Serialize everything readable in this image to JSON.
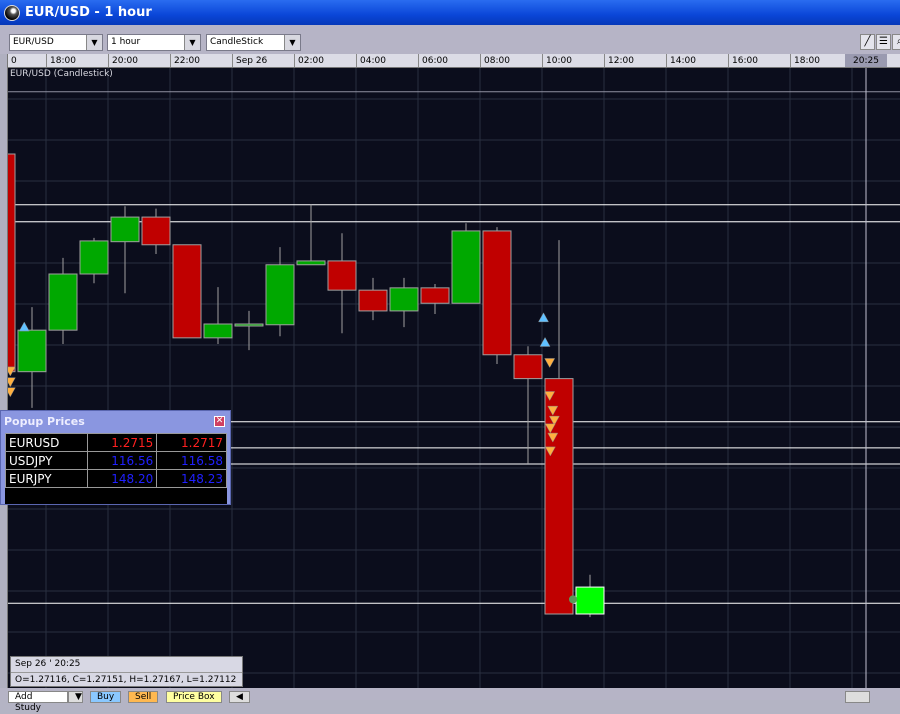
{
  "window": {
    "title": "EUR/USD - 1 hour"
  },
  "toolbar": {
    "symbol": "EUR/USD",
    "interval": "1 hour",
    "chart_type": "CandleStick",
    "tools": [
      "draw-line-icon",
      "horizontal-lines-icon",
      "zoom-icon"
    ]
  },
  "time_axis": {
    "labels": [
      "0",
      "18:00",
      "20:00",
      "22:00",
      "Sep 26",
      "02:00",
      "04:00",
      "06:00",
      "08:00",
      "10:00",
      "12:00",
      "14:00",
      "16:00",
      "18:00"
    ],
    "cursor_label": "20:25"
  },
  "chart": {
    "title": "EUR/USD (Candlestick)",
    "colors": {
      "up": "#00a800",
      "down": "#c00000",
      "last_up": "#00ff00",
      "background": "#0b0d1c",
      "grid": "#2a3040",
      "buy_marker": "#60c0ff",
      "sell_marker": "#ffb040"
    },
    "price_scale": {
      "ref_price": 1.27116
    },
    "candles": [
      {
        "o": 1.27714,
        "h": 1.27714,
        "l": 1.27431,
        "c": 1.27431
      },
      {
        "o": 1.27431,
        "h": 1.27515,
        "l": 1.27384,
        "c": 1.27485
      },
      {
        "o": 1.27485,
        "h": 1.27579,
        "l": 1.27467,
        "c": 1.27558
      },
      {
        "o": 1.27558,
        "h": 1.27605,
        "l": 1.27546,
        "c": 1.27601
      },
      {
        "o": 1.276,
        "h": 1.27646,
        "l": 1.27533,
        "c": 1.27632
      },
      {
        "o": 1.27632,
        "h": 1.27643,
        "l": 1.27584,
        "c": 1.27596
      },
      {
        "o": 1.27596,
        "h": 1.27596,
        "l": 1.27475,
        "c": 1.27475
      },
      {
        "o": 1.27475,
        "h": 1.27541,
        "l": 1.27467,
        "c": 1.27493
      },
      {
        "o": 1.27493,
        "h": 1.2751,
        "l": 1.27459,
        "c": 1.27493
      },
      {
        "o": 1.27492,
        "h": 1.27593,
        "l": 1.27477,
        "c": 1.2757
      },
      {
        "o": 1.2757,
        "h": 1.27648,
        "l": 1.2757,
        "c": 1.27575
      },
      {
        "o": 1.27575,
        "h": 1.27611,
        "l": 1.27481,
        "c": 1.27537
      },
      {
        "o": 1.27537,
        "h": 1.27553,
        "l": 1.27498,
        "c": 1.2751
      },
      {
        "o": 1.2751,
        "h": 1.27553,
        "l": 1.27489,
        "c": 1.2754
      },
      {
        "o": 1.2754,
        "h": 1.27545,
        "l": 1.27506,
        "c": 1.2752
      },
      {
        "o": 1.2752,
        "h": 1.27624,
        "l": 1.2752,
        "c": 1.27614
      },
      {
        "o": 1.27614,
        "h": 1.27619,
        "l": 1.27441,
        "c": 1.27453
      },
      {
        "o": 1.27453,
        "h": 1.27464,
        "l": 1.27312,
        "c": 1.27422
      },
      {
        "o": 1.27422,
        "h": 1.27602,
        "l": 1.27116,
        "c": 1.27116
      },
      {
        "o": 1.27116,
        "h": 1.27167,
        "l": 1.27112,
        "c": 1.27151,
        "last": true
      }
    ],
    "horizontal_lines": [
      1.27795,
      1.27648,
      1.27626,
      1.27366,
      1.27332,
      1.27311,
      1.2713
    ],
    "markers": [
      {
        "type": "buy",
        "slot": 0.75,
        "price": 1.27489
      },
      {
        "type": "buy",
        "slot": 17.5,
        "price": 1.27501
      },
      {
        "type": "buy",
        "slot": 17.55,
        "price": 1.27469
      },
      {
        "type": "sell",
        "slot": 17.7,
        "price": 1.27443
      },
      {
        "type": "sell",
        "slot": 17.7,
        "price": 1.274
      },
      {
        "type": "sell",
        "slot": 17.8,
        "price": 1.27381
      },
      {
        "type": "sell",
        "slot": 17.85,
        "price": 1.27368
      },
      {
        "type": "sell",
        "slot": 17.72,
        "price": 1.27358
      },
      {
        "type": "sell",
        "slot": 17.8,
        "price": 1.27346
      },
      {
        "type": "sell",
        "slot": 17.72,
        "price": 1.27328
      },
      {
        "type": "sell",
        "slot": 0.3,
        "price": 1.27432
      },
      {
        "type": "sell",
        "slot": 0.3,
        "price": 1.27418
      },
      {
        "type": "sell",
        "slot": 0.3,
        "price": 1.27405
      }
    ],
    "current_price": 1.27135
  },
  "popup": {
    "title": "Popup Prices",
    "rows": [
      {
        "pair": "EURUSD",
        "bid": "1.2715",
        "ask": "1.2717",
        "color": "#ff2020"
      },
      {
        "pair": "USDJPY",
        "bid": "116.56",
        "ask": "116.58",
        "color": "#2020ff"
      },
      {
        "pair": "EURJPY",
        "bid": "148.20",
        "ask": "148.23",
        "color": "#2020ff"
      }
    ]
  },
  "info": {
    "date": "Sep 26 ' 20:25",
    "ohlc": "O=1.27116, C=1.27151, H=1.27167, L=1.27112"
  },
  "bottom": {
    "add_study": "Add Study",
    "buy": "Buy",
    "sell": "Sell",
    "price_box": "Price Box"
  }
}
